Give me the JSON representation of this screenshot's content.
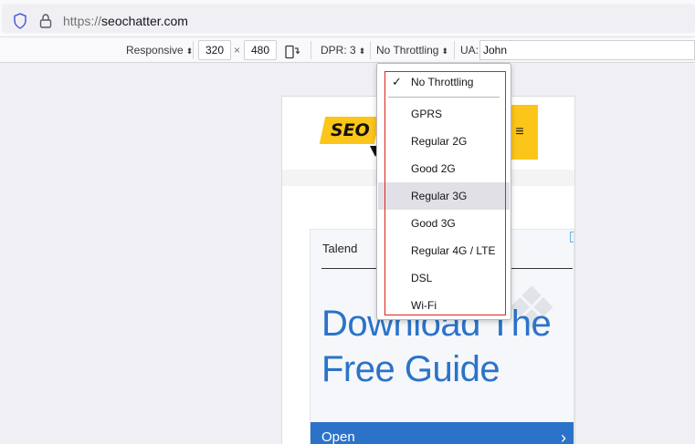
{
  "urlbar": {
    "protocol": "https://",
    "host": "seochatter.com"
  },
  "rdm_toolbar": {
    "device_select": "Responsive",
    "width": "320",
    "times": "×",
    "height": "480",
    "dpr_label": "DPR: 3",
    "throttling_select": "No Throttling",
    "ua_label": "UA:",
    "ua_value": "John"
  },
  "page": {
    "logo_text": "SEO",
    "menu_icon": "≡",
    "ad": {
      "brand": "Talend",
      "headline_1": "Download The",
      "headline_2": "Free Guide",
      "cta": "Open",
      "cta_icon": "›"
    }
  },
  "throttling_menu": {
    "checkmark": "✓",
    "items": [
      "No Throttling",
      "GPRS",
      "Regular 2G",
      "Good 2G",
      "Regular 3G",
      "Good 3G",
      "Regular 4G / LTE",
      "DSL",
      "Wi-Fi"
    ],
    "selected": "No Throttling",
    "hovered": "Regular 3G"
  },
  "colors": {
    "highlight_box": "#dd2222",
    "logo_yellow": "#fbc51a",
    "ad_blue": "#2b73c9"
  }
}
